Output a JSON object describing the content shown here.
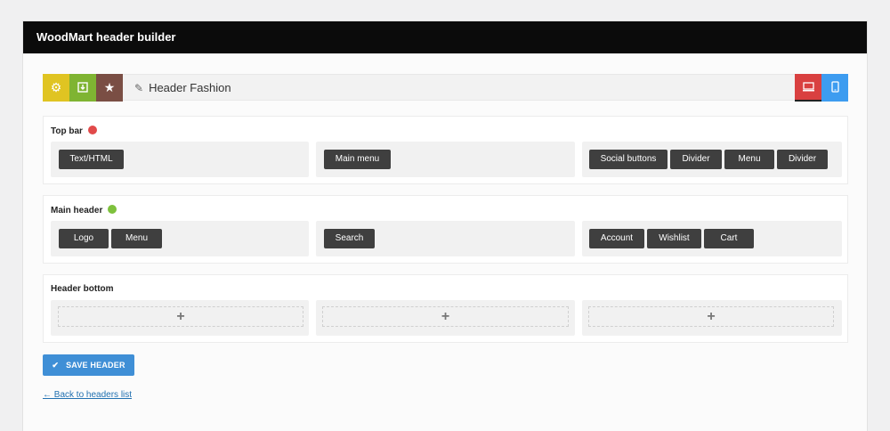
{
  "header": {
    "title": "WoodMart header builder"
  },
  "toolbar": {
    "title": "Header Fashion",
    "buttons": [
      {
        "icon": "gear-icon",
        "color": "#e0c422"
      },
      {
        "icon": "import-icon",
        "color": "#7fb432"
      },
      {
        "icon": "star-icon",
        "color": "#7a4e44"
      }
    ],
    "right_buttons": [
      {
        "icon": "desktop-icon",
        "color": "#d94040"
      },
      {
        "icon": "mobile-icon",
        "color": "#3d9cf0"
      }
    ]
  },
  "rows": [
    {
      "title": "Top bar",
      "dot_color": "#e14a4a",
      "left": [
        "Text/HTML"
      ],
      "center": [
        "Main menu"
      ],
      "right": [
        "Social buttons",
        "Divider",
        "Menu",
        "Divider"
      ]
    },
    {
      "title": "Main header",
      "dot_color": "#7ec13d",
      "left": [
        "Logo",
        "Menu"
      ],
      "center": [
        "Search"
      ],
      "right": [
        "Account",
        "Wishlist",
        "Cart"
      ]
    },
    {
      "title": "Header bottom",
      "add_symbol": "+"
    }
  ],
  "actions": {
    "save_label": "SAVE HEADER",
    "back_label": "← Back to headers list"
  }
}
